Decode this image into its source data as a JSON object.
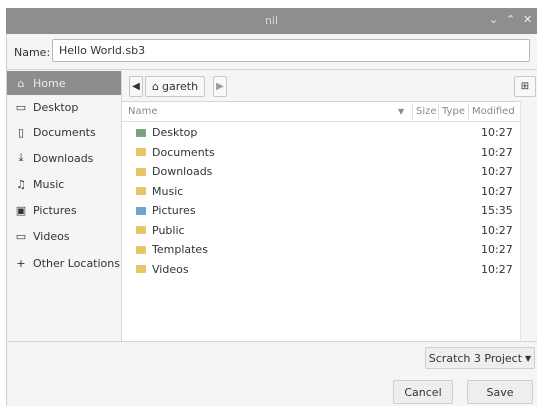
{
  "window": {
    "title": "nil"
  },
  "name_field": {
    "label": "Name:",
    "value": "Hello World.sb3"
  },
  "sidebar": {
    "items": [
      {
        "label": "Home",
        "icon": "home-icon",
        "glyph": "⌂",
        "active": true
      },
      {
        "label": "Desktop",
        "icon": "folder-icon",
        "glyph": "▭"
      },
      {
        "label": "Documents",
        "icon": "document-icon",
        "glyph": "▯"
      },
      {
        "label": "Downloads",
        "icon": "download-icon",
        "glyph": "⤓"
      },
      {
        "label": "Music",
        "icon": "music-icon",
        "glyph": "♫"
      },
      {
        "label": "Pictures",
        "icon": "picture-icon",
        "glyph": "▣"
      },
      {
        "label": "Videos",
        "icon": "video-icon",
        "glyph": "▭"
      },
      {
        "label": "Other Locations",
        "icon": "plus-icon",
        "glyph": "+"
      }
    ]
  },
  "pathbar": {
    "crumb": "gareth"
  },
  "columns": {
    "name": "Name",
    "size": "Size",
    "type": "Type",
    "modified": "Modified"
  },
  "files": [
    {
      "name": "Desktop",
      "modified": "10:27",
      "color": "#7aa37c"
    },
    {
      "name": "Documents",
      "modified": "10:27",
      "color": "#e8c468"
    },
    {
      "name": "Downloads",
      "modified": "10:27",
      "color": "#e8c468"
    },
    {
      "name": "Music",
      "modified": "10:27",
      "color": "#e8c468"
    },
    {
      "name": "Pictures",
      "modified": "15:35",
      "color": "#6fa3c9"
    },
    {
      "name": "Public",
      "modified": "10:27",
      "color": "#e8c468"
    },
    {
      "name": "Templates",
      "modified": "10:27",
      "color": "#e8c468"
    },
    {
      "name": "Videos",
      "modified": "10:27",
      "color": "#e8c468"
    }
  ],
  "filter": {
    "value": "Scratch 3 Project"
  },
  "buttons": {
    "cancel": "Cancel",
    "save": "Save"
  }
}
